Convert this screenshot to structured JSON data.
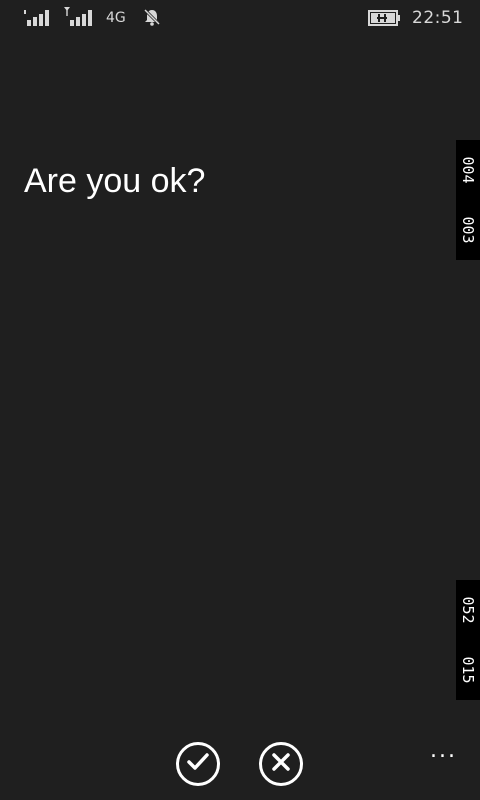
{
  "status_bar": {
    "network_type": "4G",
    "time": "22:51",
    "icons": [
      "signal-strength-icon",
      "signal-strength-roaming-icon",
      "network-type-label",
      "bell-muted-icon",
      "battery-charging-icon"
    ]
  },
  "main": {
    "question": "Are you ok?"
  },
  "side_counters": {
    "top": [
      "004",
      "003"
    ],
    "bottom": [
      "052",
      "015"
    ]
  },
  "app_bar": {
    "buttons": [
      "confirm-check-icon",
      "cancel-x-icon"
    ],
    "more_label": "..."
  },
  "colors": {
    "background": "#1f1f1f",
    "foreground": "#ffffff",
    "counter_bg": "#000000"
  }
}
